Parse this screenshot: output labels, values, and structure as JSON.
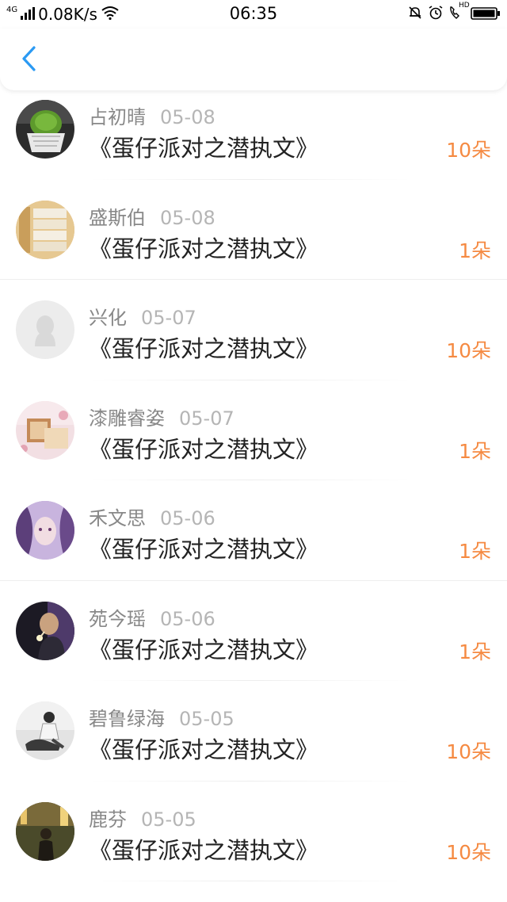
{
  "status_bar": {
    "network": "4G",
    "speed": "0.08K/s",
    "time": "06:35",
    "hd_label": "HD"
  },
  "nav": {
    "back_icon": "chevron-left-icon",
    "accent_color": "#2b9af3"
  },
  "items": [
    {
      "name": "占初晴",
      "date": "05-08",
      "title": "《蛋仔派对之潜执文》",
      "count": "10朵"
    },
    {
      "name": "盛斯伯",
      "date": "05-08",
      "title": "《蛋仔派对之潜执文》",
      "count": "1朵"
    },
    {
      "name": "兴化",
      "date": "05-07",
      "title": "《蛋仔派对之潜执文》",
      "count": "10朵"
    },
    {
      "name": "漆雕睿姿",
      "date": "05-07",
      "title": "《蛋仔派对之潜执文》",
      "count": "1朵"
    },
    {
      "name": "禾文思",
      "date": "05-06",
      "title": "《蛋仔派对之潜执文》",
      "count": "1朵"
    },
    {
      "name": "苑今瑶",
      "date": "05-06",
      "title": "《蛋仔派对之潜执文》",
      "count": "1朵"
    },
    {
      "name": "碧鲁绿海",
      "date": "05-05",
      "title": "《蛋仔派对之潜执文》",
      "count": "10朵"
    },
    {
      "name": "鹿芬",
      "date": "05-05",
      "title": "《蛋仔派对之潜执文》",
      "count": "10朵"
    }
  ],
  "colors": {
    "count": "#f58a42",
    "name": "#888888",
    "date": "#b5b5b5",
    "title": "#222222"
  }
}
